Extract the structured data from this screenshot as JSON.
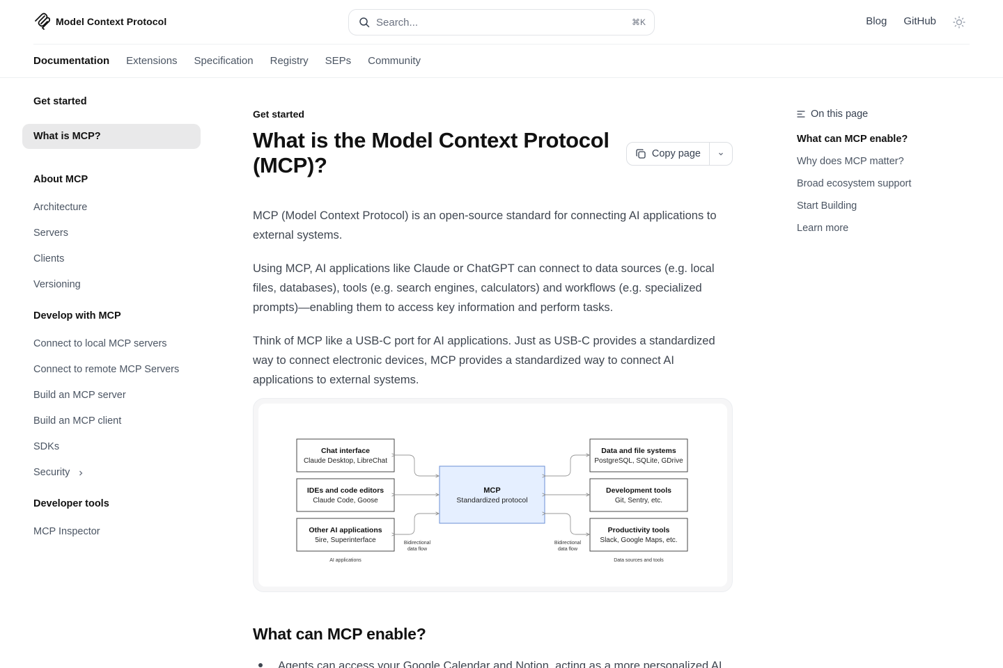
{
  "header": {
    "brand": "Model Context Protocol",
    "search_placeholder": "Search...",
    "search_shortcut": "⌘K",
    "links": [
      "Blog",
      "GitHub"
    ],
    "theme_icon": "sun-icon"
  },
  "tabs": [
    {
      "label": "Documentation",
      "active": true
    },
    {
      "label": "Extensions"
    },
    {
      "label": "Specification"
    },
    {
      "label": "Registry"
    },
    {
      "label": "SEPs"
    },
    {
      "label": "Community"
    }
  ],
  "sidebar": {
    "groups": [
      {
        "title": "Get started",
        "items": [
          {
            "label": "What is MCP?",
            "active": true
          }
        ]
      },
      {
        "title": "About MCP",
        "items": [
          {
            "label": "Architecture"
          },
          {
            "label": "Servers"
          },
          {
            "label": "Clients"
          },
          {
            "label": "Versioning"
          }
        ]
      },
      {
        "title": "Develop with MCP",
        "items": [
          {
            "label": "Connect to local MCP servers"
          },
          {
            "label": "Connect to remote MCP Servers"
          },
          {
            "label": "Build an MCP server"
          },
          {
            "label": "Build an MCP client"
          },
          {
            "label": "SDKs"
          },
          {
            "label": "Security",
            "expandable": true
          }
        ]
      },
      {
        "title": "Developer tools",
        "items": [
          {
            "label": "MCP Inspector"
          }
        ]
      }
    ]
  },
  "main": {
    "eyebrow": "Get started",
    "title": "What is the Model Context Protocol (MCP)?",
    "copy_button": "Copy page",
    "paragraphs": [
      "MCP (Model Context Protocol) is an open-source standard for connecting AI applications to external systems.",
      "Using MCP, AI applications like Claude or ChatGPT can connect to data sources (e.g. local files, databases), tools (e.g. search engines, calculators) and workflows (e.g. specialized prompts)—enabling them to access key information and perform tasks.",
      "Think of MCP like a USB-C port for AI applications. Just as USB-C provides a standardized way to connect electronic devices, MCP provides a standardized way to connect AI applications to external systems."
    ],
    "diagram": {
      "left": [
        {
          "title": "Chat interface",
          "sub": "Claude Desktop, LibreChat"
        },
        {
          "title": "IDEs and code editors",
          "sub": "Claude Code, Goose"
        },
        {
          "title": "Other AI applications",
          "sub": "5ire, Superinterface"
        }
      ],
      "left_caption": "AI applications",
      "center": {
        "title": "MCP",
        "sub": "Standardized protocol"
      },
      "right": [
        {
          "title": "Data and file systems",
          "sub": "PostgreSQL, SQLite, GDrive"
        },
        {
          "title": "Development tools",
          "sub": "Git, Sentry, etc."
        },
        {
          "title": "Productivity tools",
          "sub": "Slack, Google Maps, etc."
        }
      ],
      "right_caption": "Data sources and tools",
      "flow_label_1": "Bidirectional",
      "flow_label_2": "data flow"
    },
    "section_heading": "What can MCP enable?",
    "first_bullet": "Agents can access your Google Calendar and Notion, acting as a more personalized AI"
  },
  "toc": {
    "heading": "On this page",
    "items": [
      {
        "label": "What can MCP enable?",
        "active": true
      },
      {
        "label": "Why does MCP matter?"
      },
      {
        "label": "Broad ecosystem support"
      },
      {
        "label": "Start Building"
      },
      {
        "label": "Learn more"
      }
    ]
  },
  "colors": {
    "mcp_box_fill": "#e5efff",
    "mcp_box_stroke": "#6b8fd6",
    "active_item_bg": "#e9e9ea"
  }
}
